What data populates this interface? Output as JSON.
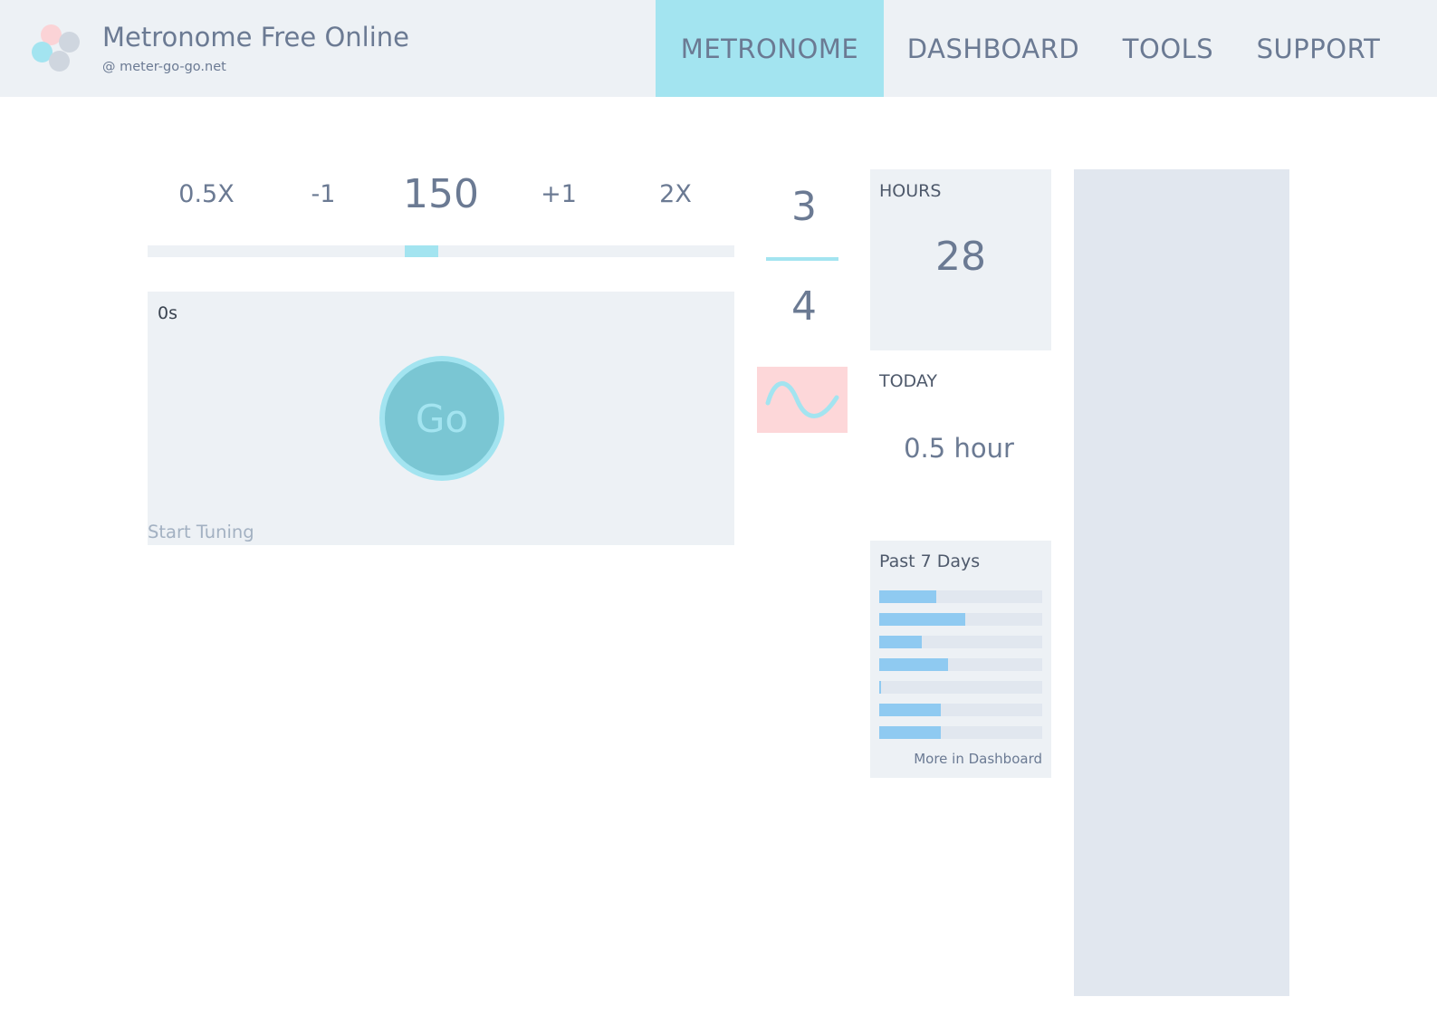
{
  "header": {
    "title": "Metronome Free Online",
    "subtitle": "@ meter-go-go.net",
    "nav": [
      {
        "label": "METRONOME",
        "active": true
      },
      {
        "label": "DASHBOARD",
        "active": false
      },
      {
        "label": "TOOLS",
        "active": false
      },
      {
        "label": "SUPPORT",
        "active": false
      }
    ]
  },
  "tempo": {
    "half_label": "0.5X",
    "minus_label": "-1",
    "bpm": "150",
    "plus_label": "+1",
    "double_label": "2X"
  },
  "tuning": {
    "timer": "0s",
    "go_label": "Go",
    "start_label": "Start Tuning"
  },
  "time_signature": {
    "beats": "3",
    "note_value": "4",
    "sound_icon": "sine-wave-icon"
  },
  "stats": {
    "hours_label": "HOURS",
    "hours_value": "28",
    "today_label": "TODAY",
    "today_value": "0.5 hour",
    "past_label": "Past 7 Days",
    "past_days_fraction": [
      0.35,
      0.53,
      0.26,
      0.42,
      0.01,
      0.38,
      0.38
    ],
    "more_link": "More in Dashboard"
  },
  "colors": {
    "accent": "#a3e4f0",
    "panel": "#edf1f5",
    "text": "#6b7a93",
    "bar": "#8fcaf1",
    "sound_bg": "#fdd7d9"
  }
}
